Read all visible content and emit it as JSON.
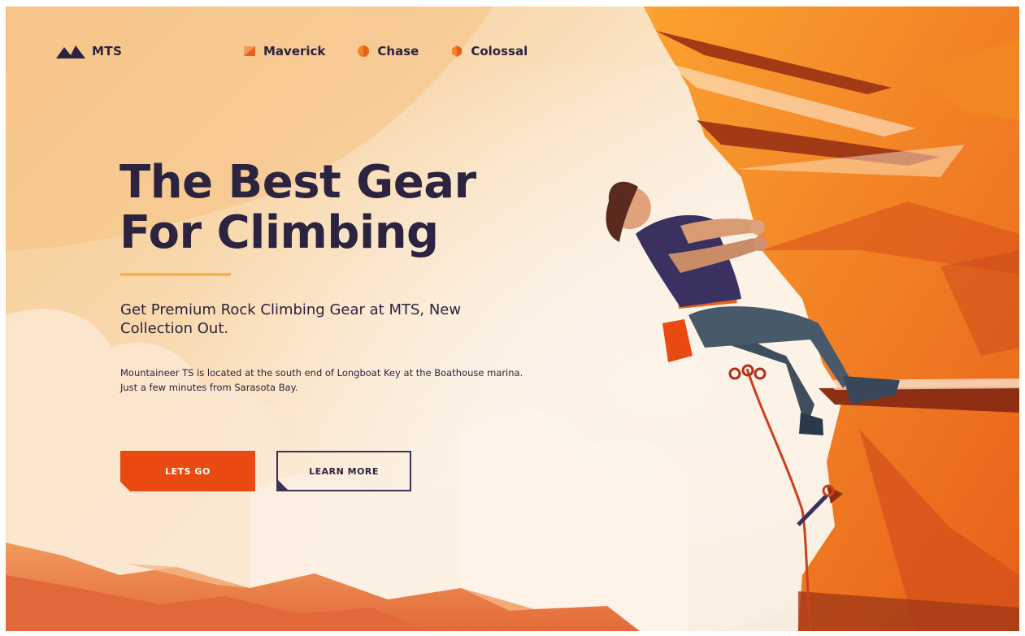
{
  "brand": {
    "name": "MTS",
    "icon": "mountain-icon"
  },
  "nav": {
    "items": [
      {
        "label": "Maverick",
        "icon": "square-bullet-icon"
      },
      {
        "label": "Chase",
        "icon": "circle-bullet-icon"
      },
      {
        "label": "Colossal",
        "icon": "hexagon-bullet-icon"
      }
    ]
  },
  "hero": {
    "title_line1": "The Best Gear",
    "title_line2": "For Climbing",
    "subtitle": "Get Premium Rock Climbing Gear at MTS, New Collection Out.",
    "description": "Mountaineer TS  is located at the south end of Longboat Key at the Boathouse marina. Just a few minutes from Sarasota Bay.",
    "primary_button": "LETS GO",
    "secondary_button": "LEARN MORE"
  },
  "colors": {
    "text_dark": "#2b2340",
    "accent_orange": "#e84a12",
    "accent_line": "#f6b44a",
    "rock_orange": "#f0781a"
  }
}
